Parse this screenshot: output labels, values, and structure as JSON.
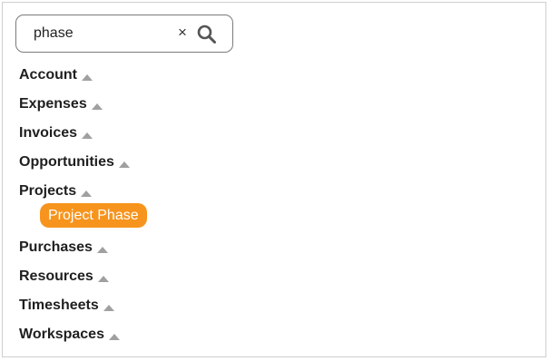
{
  "search": {
    "value": "phase",
    "clear_label": "×",
    "icon": "search-icon"
  },
  "categories": [
    {
      "label": "Account",
      "icon": "caret-up-icon"
    },
    {
      "label": "Expenses",
      "icon": "caret-up-icon"
    },
    {
      "label": "Invoices",
      "icon": "caret-up-icon"
    },
    {
      "label": "Opportunities",
      "icon": "caret-up-icon"
    },
    {
      "label": "Projects",
      "icon": "caret-up-icon",
      "results": [
        {
          "label": "Project Phase",
          "highlighted": true
        }
      ]
    },
    {
      "label": "Purchases",
      "icon": "caret-up-icon"
    },
    {
      "label": "Resources",
      "icon": "caret-up-icon"
    },
    {
      "label": "Timesheets",
      "icon": "caret-up-icon"
    },
    {
      "label": "Workspaces",
      "icon": "caret-up-icon"
    }
  ],
  "colors": {
    "highlight": "#f7941d",
    "caret": "#a0a0a0",
    "border": "#7b7b7b"
  }
}
